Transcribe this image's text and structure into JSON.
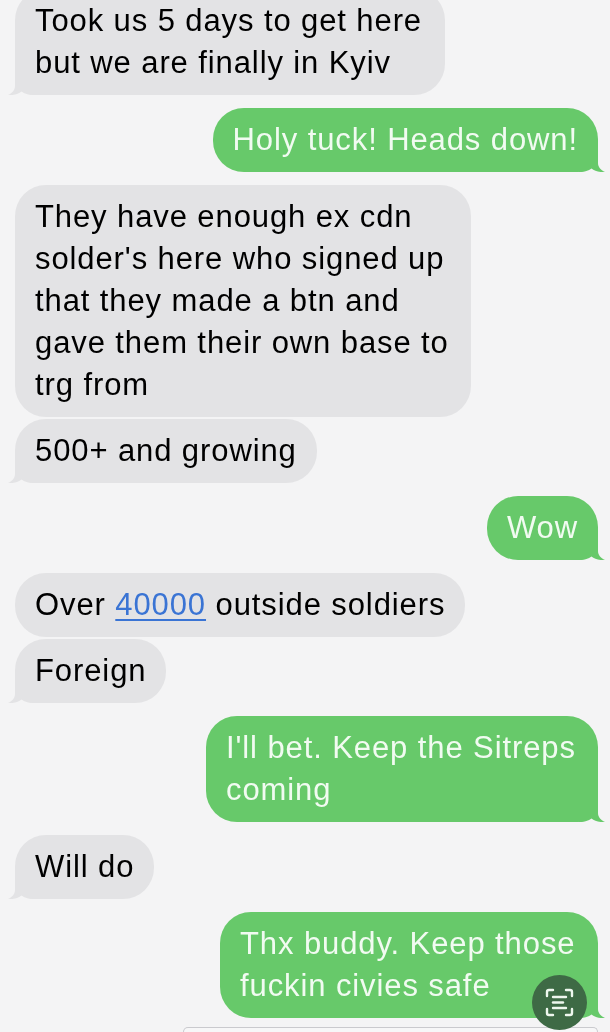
{
  "messages": [
    {
      "kind": "received",
      "tail": true,
      "parts": [
        {
          "kind": "text",
          "text": "Took us 5 days to get here but we are finally in Kyiv"
        }
      ]
    },
    {
      "kind": "sent",
      "tail": true,
      "parts": [
        {
          "kind": "text",
          "text": "Holy tuck! Heads down!"
        }
      ]
    },
    {
      "kind": "received",
      "tail": false,
      "parts": [
        {
          "kind": "text",
          "text": "They have enough ex cdn solder's here who signed up that they made a btn and gave them their own base to trg from"
        }
      ]
    },
    {
      "kind": "received",
      "tail": true,
      "parts": [
        {
          "kind": "text",
          "text": "500+ and growing"
        }
      ]
    },
    {
      "kind": "sent",
      "tail": true,
      "parts": [
        {
          "kind": "text",
          "text": "Wow"
        }
      ]
    },
    {
      "kind": "received",
      "tail": false,
      "parts": [
        {
          "kind": "text",
          "text": "Over "
        },
        {
          "kind": "link",
          "text": "40000"
        },
        {
          "kind": "text",
          "text": " outside soldiers"
        }
      ]
    },
    {
      "kind": "received",
      "tail": true,
      "parts": [
        {
          "kind": "text",
          "text": "Foreign"
        }
      ]
    },
    {
      "kind": "sent",
      "tail": true,
      "parts": [
        {
          "kind": "text",
          "text": "I'll bet. Keep the Sitreps coming"
        }
      ]
    },
    {
      "kind": "received",
      "tail": true,
      "parts": [
        {
          "kind": "text",
          "text": "Will do"
        }
      ]
    },
    {
      "kind": "sent",
      "tail": true,
      "parts": [
        {
          "kind": "text",
          "text": "Thx buddy. Keep those fuckin civies safe"
        }
      ]
    }
  ]
}
